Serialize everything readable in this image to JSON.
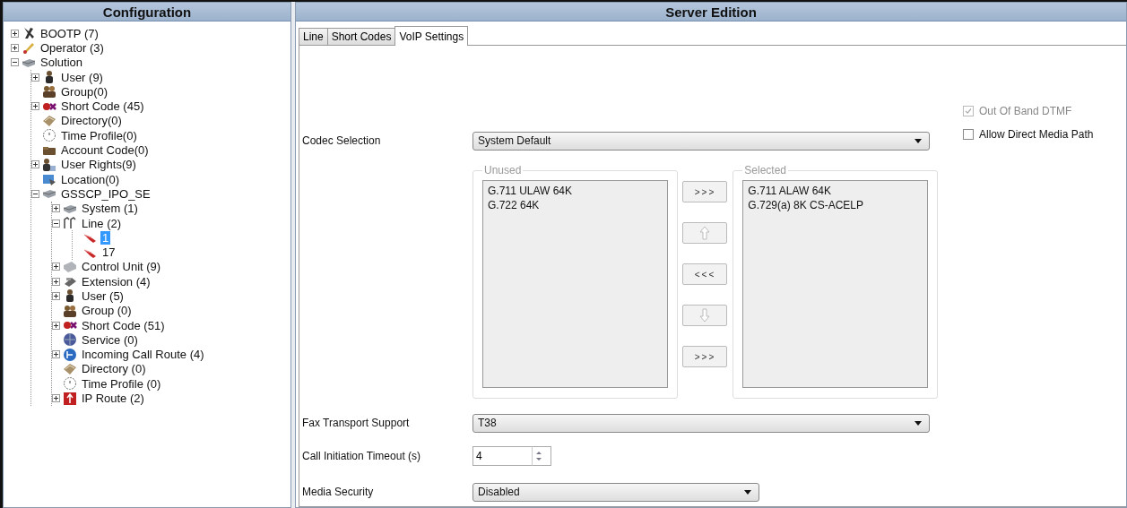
{
  "left_panel": {
    "title": "Configuration",
    "tree": [
      {
        "label": "BOOTP (7)",
        "kind": "bootp",
        "expanded": false,
        "selected": false
      },
      {
        "label": "Operator (3)",
        "kind": "operator",
        "expanded": false,
        "selected": false
      },
      {
        "label": "Solution",
        "kind": "system",
        "expanded": true,
        "selected": false,
        "children": [
          {
            "label": "User (9)",
            "kind": "user",
            "expanded": false,
            "selected": false
          },
          {
            "label": "Group(0)",
            "kind": "group",
            "selected": false
          },
          {
            "label": "Short Code (45)",
            "kind": "shortcode",
            "expanded": false,
            "selected": false
          },
          {
            "label": "Directory(0)",
            "kind": "directory",
            "selected": false
          },
          {
            "label": "Time Profile(0)",
            "kind": "clock",
            "selected": false
          },
          {
            "label": "Account Code(0)",
            "kind": "account",
            "selected": false
          },
          {
            "label": "User Rights(9)",
            "kind": "rights",
            "expanded": false,
            "selected": false
          },
          {
            "label": "Location(0)",
            "kind": "location",
            "selected": false
          },
          {
            "label": "GSSCP_IPO_SE",
            "kind": "system",
            "expanded": true,
            "selected": false,
            "children": [
              {
                "label": "System (1)",
                "kind": "system",
                "expanded": false,
                "selected": false
              },
              {
                "label": "Line (2)",
                "kind": "line",
                "expanded": true,
                "selected": false,
                "children": [
                  {
                    "label": "1",
                    "kind": "cable",
                    "selected": true
                  },
                  {
                    "label": "17",
                    "kind": "cable",
                    "selected": false
                  }
                ]
              },
              {
                "label": "Control Unit (9)",
                "kind": "unit",
                "expanded": false,
                "selected": false
              },
              {
                "label": "Extension (4)",
                "kind": "phone",
                "expanded": false,
                "selected": false
              },
              {
                "label": "User (5)",
                "kind": "user",
                "expanded": false,
                "selected": false
              },
              {
                "label": "Group (0)",
                "kind": "group",
                "selected": false
              },
              {
                "label": "Short Code (51)",
                "kind": "shortcode",
                "expanded": false,
                "selected": false
              },
              {
                "label": "Service (0)",
                "kind": "globe",
                "selected": false
              },
              {
                "label": "Incoming Call Route (4)",
                "kind": "route",
                "expanded": false,
                "selected": false
              },
              {
                "label": "Directory (0)",
                "kind": "directory",
                "selected": false
              },
              {
                "label": "Time Profile (0)",
                "kind": "clock",
                "selected": false
              },
              {
                "label": "IP Route (2)",
                "kind": "iproute",
                "expanded": false,
                "selected": false
              }
            ]
          }
        ]
      }
    ]
  },
  "right_panel": {
    "title": "Server Edition",
    "tabs": [
      {
        "label": "Line",
        "selected": false
      },
      {
        "label": "Short Codes",
        "selected": false
      },
      {
        "label": "VoIP Settings",
        "selected": true
      }
    ],
    "checkboxes": [
      {
        "label": "Out Of Band DTMF",
        "checked": true,
        "disabled": true
      },
      {
        "label": "Allow Direct Media Path",
        "checked": false,
        "disabled": false
      }
    ],
    "codec_selection": {
      "label": "Codec Selection",
      "value": "System Default"
    },
    "unused": {
      "title": "Unused",
      "items": [
        "G.711 ULAW 64K",
        "G.722 64K"
      ]
    },
    "move_buttons": [
      {
        "kind": "text",
        "label": ">>>",
        "disabled": false
      },
      {
        "kind": "up",
        "disabled": true
      },
      {
        "kind": "text",
        "label": "<<<",
        "disabled": false
      },
      {
        "kind": "down",
        "disabled": true
      },
      {
        "kind": "text",
        "label": ">>>",
        "disabled": false
      }
    ],
    "selected_codecs": {
      "title": "Selected",
      "items": [
        "G.711 ALAW 64K",
        "G.729(a) 8K CS-ACELP"
      ]
    },
    "fax_transport": {
      "label": "Fax Transport Support",
      "value": "T38"
    },
    "call_initiation_timeout": {
      "label": "Call Initiation Timeout (s)",
      "value": "4"
    },
    "media_security": {
      "label": "Media Security",
      "value": "Disabled"
    }
  }
}
